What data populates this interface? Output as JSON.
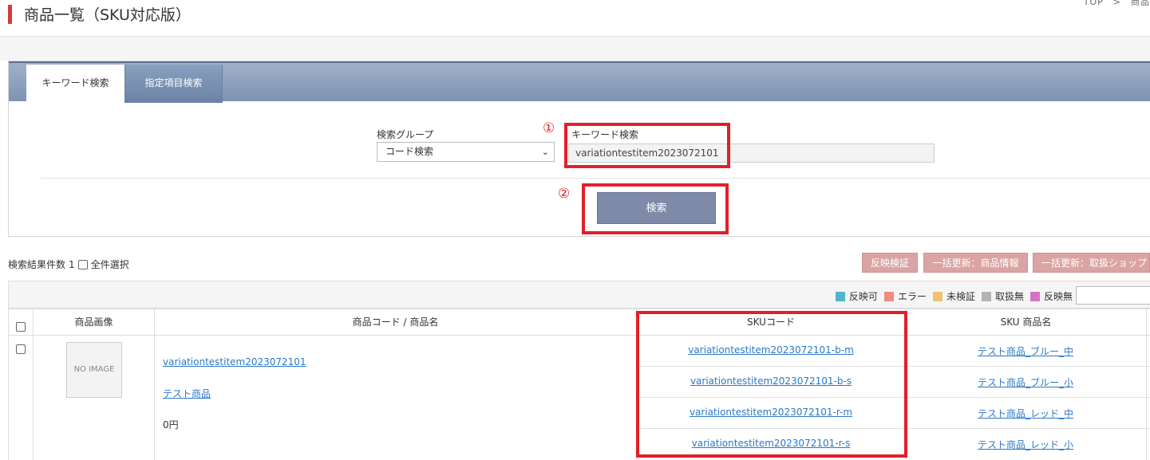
{
  "page": {
    "title": "商品一覧（SKU対応版）",
    "breadcrumb": "TOP　>　商品"
  },
  "search": {
    "tabs": [
      {
        "label": "キーワード検索",
        "active": true
      },
      {
        "label": "指定項目検索",
        "active": false
      }
    ],
    "group_label": "検索グループ",
    "group_value": "コード検索",
    "keyword_label": "キーワード検索",
    "keyword_value": "variationtestitem2023072101",
    "submit_label": "検索",
    "annotation_1": "①",
    "annotation_2": "②"
  },
  "results": {
    "count_label": "検索結果件数",
    "count": "1",
    "select_all_label": "全件選択",
    "actions": [
      "反映検証",
      "一括更新：商品情報",
      "一括更新：取扱ショップ"
    ]
  },
  "legend": [
    {
      "label": "反映可",
      "color": "#4fb8c8"
    },
    {
      "label": "エラー",
      "color": "#ef8c7e"
    },
    {
      "label": "未検証",
      "color": "#f2c073"
    },
    {
      "label": "取扱無",
      "color": "#b3b3b3"
    },
    {
      "label": "反映無",
      "color": "#d274c4"
    }
  ],
  "table": {
    "headers": [
      "商品画像",
      "商品コード / 商品名",
      "SKUコード",
      "SKU 商品名"
    ],
    "row": {
      "image_placeholder": "NO IMAGE",
      "item_code": "variationtestitem2023072101",
      "item_name": "テスト商品",
      "price": "0円",
      "skus": [
        {
          "code": "variationtestitem2023072101-b-m",
          "name": "テスト商品_ブルー_中"
        },
        {
          "code": "variationtestitem2023072101-b-s",
          "name": "テスト商品_ブルー_小"
        },
        {
          "code": "variationtestitem2023072101-r-m",
          "name": "テスト商品_レッド_中"
        },
        {
          "code": "variationtestitem2023072101-r-s",
          "name": "テスト商品_レッド_小"
        }
      ]
    }
  }
}
